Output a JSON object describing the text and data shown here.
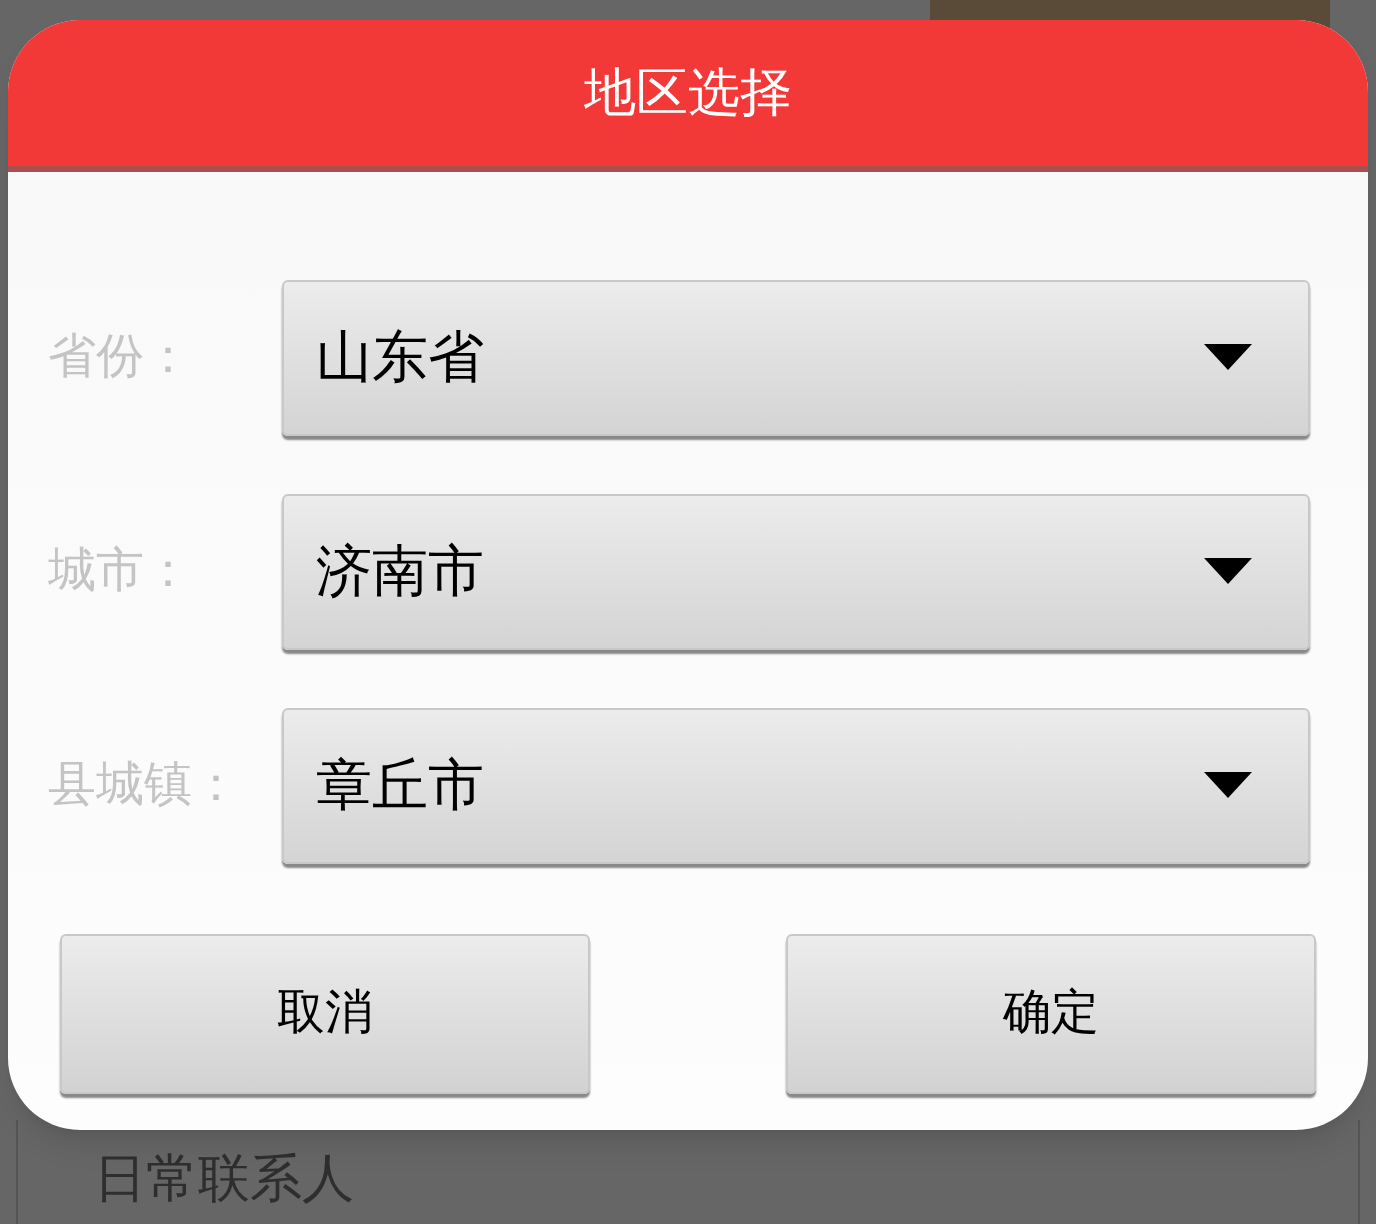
{
  "dialog": {
    "title": "地区选择",
    "fields": [
      {
        "label": "省份：",
        "value": "山东省"
      },
      {
        "label": "城市：",
        "value": "济南市"
      },
      {
        "label": "县城镇：",
        "value": "章丘市"
      }
    ],
    "buttons": [
      "取消",
      "确定"
    ]
  },
  "background": {
    "heading": "日常联系人"
  }
}
